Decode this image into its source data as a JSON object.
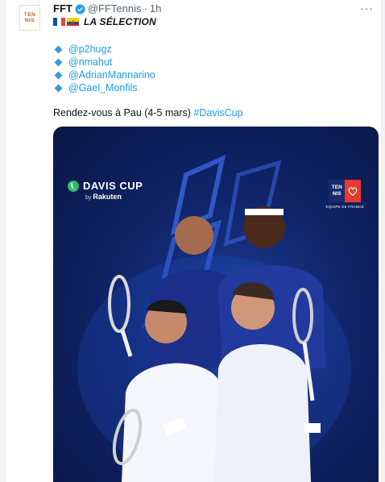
{
  "tweet": {
    "author_name": "FFT",
    "handle": "@FFTennis",
    "separator": "·",
    "time": "1h",
    "more": "···",
    "avatar_lines": [
      "TEN",
      "NIS"
    ],
    "selection_label": "LA SÉLECTION",
    "mentions": [
      "@p2hugz",
      "@nmahut",
      "@AdrianMannarino",
      "@Gael_Monfils"
    ],
    "body_text": "Rendez-vous à Pau (4-5 mars)",
    "hashtag": "#DavisCup"
  },
  "media": {
    "davis_cup_title": "DAVIS CUP",
    "davis_cup_by": "by",
    "davis_cup_sponsor": "Rakuten",
    "tennis_badge_left": [
      "TEN",
      "NIS"
    ],
    "tennis_badge_caption": "EQUIPE DE FRANCE"
  },
  "colors": {
    "link": "#1d9bf0",
    "bullet": "#3a9ad9",
    "media_background": "#10256a",
    "davis_green": "#2fbf6a"
  },
  "icons": {
    "verified": "verified-badge-icon",
    "flag_fr": "france-flag-icon",
    "flag_ec": "ecuador-flag-icon",
    "more": "more-options-icon"
  }
}
